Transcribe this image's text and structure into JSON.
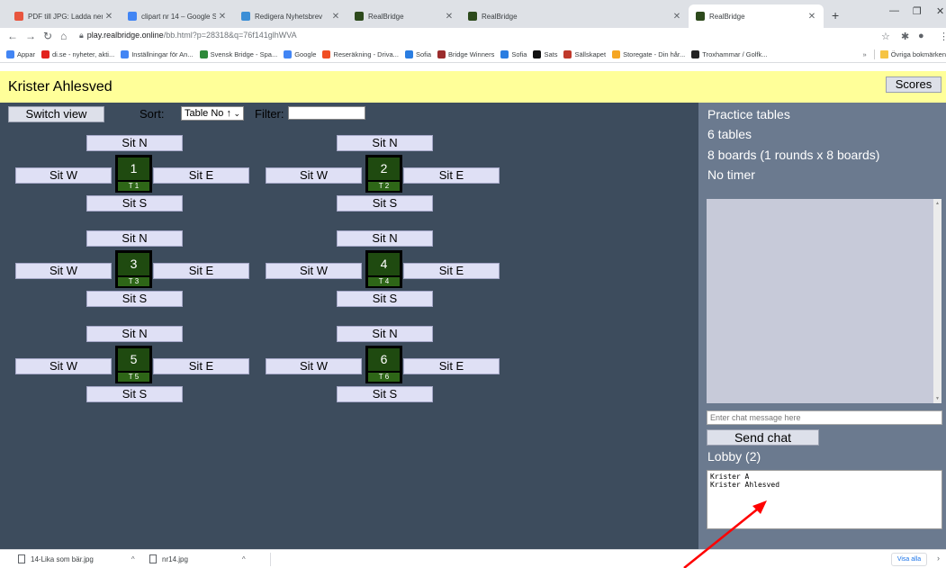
{
  "browser": {
    "tabs": [
      {
        "title": "PDF till JPG: Ladda ner fil(er)",
        "icon": "pdf-converter-favicon",
        "color": "#e8553e",
        "active": false
      },
      {
        "title": "clipart nr 14 – Google Sök",
        "icon": "google-favicon",
        "color": "#4285f4",
        "active": false
      },
      {
        "title": "Redigera Nyhetsbrev",
        "icon": "newsletter-favicon",
        "color": "#3b8ed6",
        "active": false
      },
      {
        "title": "RealBridge",
        "icon": "realbridge-favicon",
        "color": "#2d4a1c",
        "active": false
      },
      {
        "title": "RealBridge",
        "icon": "realbridge-favicon",
        "color": "#2d4a1c",
        "active": false
      },
      {
        "title": "RealBridge",
        "icon": "realbridge-favicon",
        "color": "#2d4a1c",
        "active": true
      }
    ],
    "url_domain": "play.realbridge.online",
    "url_path": "/bb.html?p=28318&q=76f141glhWVA",
    "bookmarks": [
      {
        "label": "Appar",
        "icon": "apps-grid-icon",
        "color": "#4285f4"
      },
      {
        "label": "di.se - nyheter, akti...",
        "icon": "di-favicon",
        "color": "#e2211c"
      },
      {
        "label": "Inställningar för An...",
        "icon": "google-favicon",
        "color": "#4285f4"
      },
      {
        "label": "Svensk Bridge - Spa...",
        "icon": "svensk-bridge-favicon",
        "color": "#2f8a3b"
      },
      {
        "label": "Google",
        "icon": "google-favicon",
        "color": "#4285f4"
      },
      {
        "label": "Reseräkning - Driva...",
        "icon": "drive-favicon",
        "color": "#f04e23"
      },
      {
        "label": "Sofia",
        "icon": "sofia-favicon",
        "color": "#2a7de1"
      },
      {
        "label": "Bridge Winners",
        "icon": "bridge-winners-favicon",
        "color": "#9b2c2c"
      },
      {
        "label": "Sofia",
        "icon": "sofia-favicon",
        "color": "#2a7de1"
      },
      {
        "label": "Sats",
        "icon": "sats-favicon",
        "color": "#111111"
      },
      {
        "label": "Sällskapet",
        "icon": "sallskapet-favicon",
        "color": "#c0392b"
      },
      {
        "label": "Storegate - Din hår...",
        "icon": "storegate-favicon",
        "color": "#f5a623"
      },
      {
        "label": "Troxhammar / Golfk...",
        "icon": "flag-favicon",
        "color": "#222222"
      }
    ],
    "more_bookmarks": "»",
    "other_bookmarks": "Övriga bokmärken",
    "downloads": [
      {
        "name": "14-Lika som bär.jpg"
      },
      {
        "name": "nr14.jpg"
      }
    ],
    "show_all": "Visa alla"
  },
  "page": {
    "player_name": "Krister Ahlesved",
    "scores_label": "Scores",
    "switch_view_label": "Switch view",
    "sort_label": "Sort:",
    "sort_value": "Table No ↑",
    "filter_label": "Filter:",
    "filter_value": "",
    "seat_labels": {
      "north": "Sit N",
      "south": "Sit S",
      "west": "Sit W",
      "east": "Sit E"
    },
    "tables": [
      {
        "number": "1",
        "tag": "T 1"
      },
      {
        "number": "2",
        "tag": "T 2"
      },
      {
        "number": "3",
        "tag": "T 3"
      },
      {
        "number": "4",
        "tag": "T 4"
      },
      {
        "number": "5",
        "tag": "T 5"
      },
      {
        "number": "6",
        "tag": "T 6"
      }
    ],
    "side": {
      "title": "Practice tables",
      "table_count": "6 tables",
      "boards": "8 boards (1 rounds x 8 boards)",
      "timer": "No timer",
      "chat_placeholder": "Enter chat message here",
      "send_chat_label": "Send chat",
      "lobby_label": "Lobby (2)",
      "lobby_members": [
        "Krister A",
        "Krister Ahlesved"
      ]
    }
  },
  "colors": {
    "header_bg": "#ffff99",
    "main_bg": "#3d4c5d",
    "side_bg": "#6b7a8f",
    "table_green": "#1f4a10",
    "annotation_arrow": "#ff0000"
  }
}
